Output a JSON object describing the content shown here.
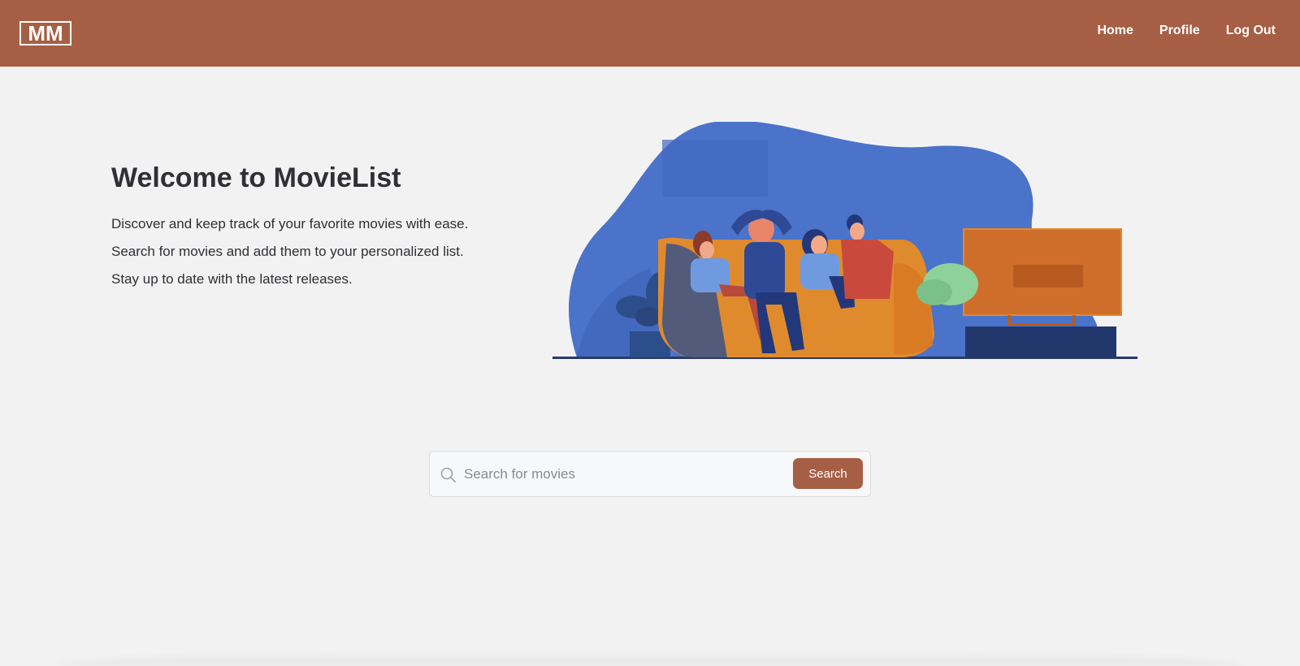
{
  "navbar": {
    "logo_text": "MM",
    "links": [
      {
        "label": "Home"
      },
      {
        "label": "Profile"
      },
      {
        "label": "Log Out"
      }
    ]
  },
  "hero": {
    "title": "Welcome to MovieList",
    "lines": [
      "Discover and keep track of your favorite movies with ease.",
      "Search for movies and add them to your personalized list.",
      "Stay up to date with the latest releases."
    ]
  },
  "search": {
    "placeholder": "Search for movies",
    "value": "",
    "button_label": "Search"
  },
  "colors": {
    "brand": "#a65f45",
    "background": "#f2f2f2",
    "text": "#2f2f35",
    "illustration_blue": "#4a73c9",
    "illustration_orange": "#e08a2e"
  },
  "icons": {
    "search": "search-icon",
    "logo": "logo-icon"
  }
}
